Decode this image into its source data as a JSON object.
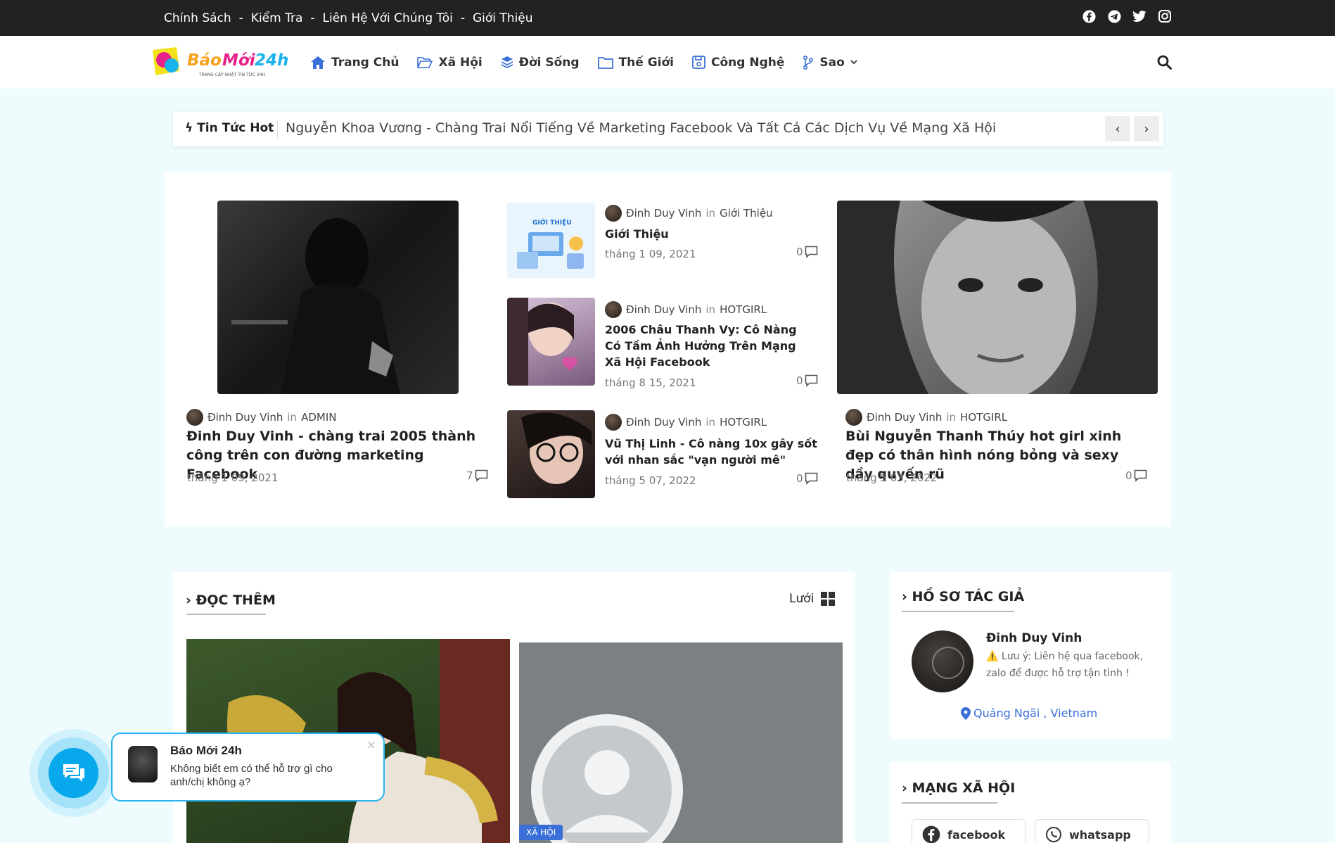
{
  "topbar": {
    "links": [
      "Chính Sách",
      "Kiểm Tra",
      "Liên Hệ Với Chúng Tôi",
      "Giới Thiệu"
    ],
    "separator": "-",
    "social_icons": [
      "facebook-icon",
      "telegram-icon",
      "twitter-icon",
      "instagram-icon"
    ]
  },
  "header": {
    "logo_text": "BáoMới24h",
    "logo_tagline": "TRANG CẬP NHẬT TIN TỨC 24H",
    "nav": [
      {
        "label": "Trang Chủ",
        "icon": "home-icon"
      },
      {
        "label": "Xã Hội",
        "icon": "folder-open-icon"
      },
      {
        "label": "Đời Sống",
        "icon": "layers-icon"
      },
      {
        "label": "Thế Giới",
        "icon": "folder-icon"
      },
      {
        "label": "Công Nghệ",
        "icon": "save-icon"
      },
      {
        "label": "Sao",
        "icon": "branch-icon"
      }
    ]
  },
  "ticker": {
    "label": "Tin Tức Hot",
    "text": "Nguyễn Khoa Vương - Chàng Trai Nổi Tiếng Về Marketing Facebook Và Tất Cả Các Dịch Vụ Về Mạng Xã Hội",
    "prev": "‹",
    "next": "›"
  },
  "featured": {
    "in_label": "in",
    "left": {
      "author": "Đinh Duy Vinh",
      "category": "ADMIN",
      "title": "Đinh Duy Vinh - chàng trai 2005 thành công trên con đường marketing Facebook",
      "date": "tháng 1 09, 2021",
      "comments": "7"
    },
    "middle": [
      {
        "author": "Đinh Duy Vinh",
        "category": "Giới Thiệu",
        "title": "Giới Thiệu",
        "date": "tháng 1 09, 2021",
        "comments": "0",
        "thumb_text": "GIỚI THIỆU"
      },
      {
        "author": "Đinh Duy Vinh",
        "category": "HOTGIRL",
        "title": "2006 Châu Thanh Vy: Cô Nàng Có Tầm Ảnh Hưởng Trên Mạng Xã Hội Facebook",
        "date": "tháng 8 15, 2021",
        "comments": "0"
      },
      {
        "author": "Đinh Duy Vinh",
        "category": "HOTGIRL",
        "title": "Vũ Thị Linh - Cô nàng 10x gây sốt với nhan sắc \"vạn người mê\"",
        "date": "tháng 5 07, 2022",
        "comments": "0"
      }
    ],
    "right": {
      "author": "Đinh Duy Vinh",
      "category": "HOTGIRL",
      "title": "Bùi Nguyễn Thanh Thúy hot girl xinh đẹp có thân hình nóng bỏng và sexy dầy quyến rũ",
      "date": "tháng 5 03, 2022",
      "comments": "0"
    }
  },
  "read_more": {
    "title": "ĐỌC THÊM",
    "view_label": "Lưới",
    "badge": "XÃ HỘI"
  },
  "author_widget": {
    "title": "HỒ SƠ TÁC GIẢ",
    "name": "Đinh Duy Vinh",
    "note": "Lưu ý: Liên hệ qua facebook, zalo để được hỗ trợ tận tình !",
    "location": "Quảng Ngãi , Vietnam"
  },
  "social_widget": {
    "title": "MẠNG XÃ HỘI",
    "buttons": [
      "facebook",
      "whatsapp"
    ]
  },
  "chat": {
    "name": "Báo Mới 24h",
    "message": "Không biết em có thể hỗ trợ gì cho anh/chị không ạ?",
    "close": "×"
  },
  "colors": {
    "accent": "#3a6fd8",
    "topbar_bg": "#222222",
    "page_bg": "#eefcfd",
    "chat_blue": "#08a8ed"
  }
}
